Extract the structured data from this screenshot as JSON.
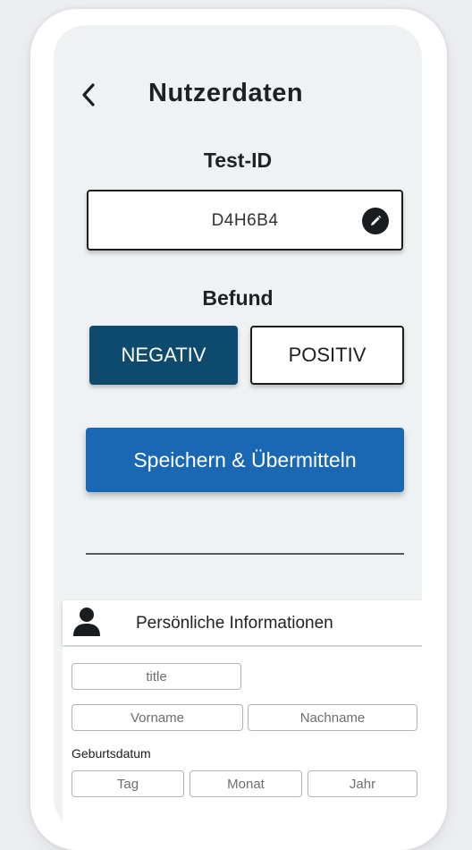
{
  "header": {
    "title": "Nutzerdaten"
  },
  "test": {
    "label": "Test-ID",
    "value": "D4H6B4"
  },
  "result": {
    "label": "Befund",
    "negative": "NEGATIV",
    "positive": "POSITIV"
  },
  "actions": {
    "save": "Speichern & Übermitteln"
  },
  "personal": {
    "title": "Persönliche Informationen",
    "title_placeholder": "title",
    "firstname_placeholder": "Vorname",
    "lastname_placeholder": "Nachname",
    "dob_label": "Geburtsdatum",
    "day_placeholder": "Tag",
    "month_placeholder": "Monat",
    "year_placeholder": "Jahr"
  },
  "colors": {
    "primary": "#1a68b3",
    "selected": "#0d4a6e",
    "background": "#eff2f3"
  }
}
